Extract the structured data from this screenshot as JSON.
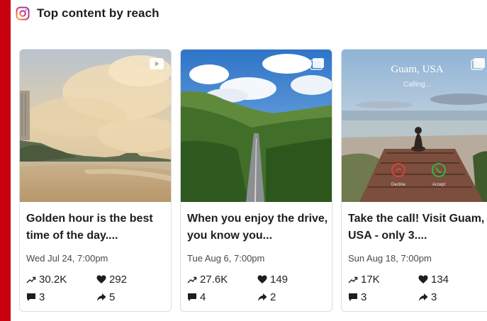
{
  "header": {
    "title": "Top content by reach",
    "icon": "instagram-icon"
  },
  "cards": [
    {
      "badge": "video-icon",
      "caption": "Golden hour is the best time of the day....",
      "date": "Wed Jul 24, 7:00pm",
      "reach": "30.2K",
      "likes": "292",
      "comments": "3",
      "shares": "5"
    },
    {
      "badge": "carousel-icon",
      "caption": "When you enjoy the drive, you know you...",
      "date": "Tue Aug 6, 7:00pm",
      "reach": "27.6K",
      "likes": "149",
      "comments": "4",
      "shares": "2"
    },
    {
      "badge": "carousel-icon",
      "overlay_title": "Guam, USA",
      "overlay_subtitle": "Calling...",
      "decline": "Decline",
      "accept": "Accept",
      "caption": "Take the call! Visit Guam, USA - only 3....",
      "date": "Sun Aug 18, 7:00pm",
      "reach": "17K",
      "likes": "134",
      "comments": "3",
      "shares": "3"
    }
  ],
  "colors": {
    "accent_bar": "#c8000f",
    "border": "#dadde1",
    "muted_text": "#444950"
  }
}
